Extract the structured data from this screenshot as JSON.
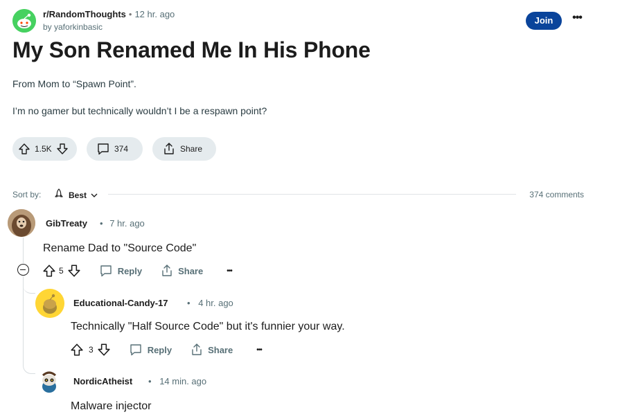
{
  "post": {
    "subreddit": "r/RandomThoughts",
    "time": "12 hr. ago",
    "author": "by yaforkinbasic",
    "join_label": "Join",
    "more_label": "•••",
    "title": "My Son Renamed Me In His Phone",
    "body_lines": [
      "From Mom to “Spawn Point”.",
      "I’m no gamer but technically wouldn’t I be a respawn point?"
    ],
    "votes": "1.5K",
    "comments": "374",
    "share_label": "Share"
  },
  "sort": {
    "label": "Sort by:",
    "value": "Best",
    "comment_count": "374 comments"
  },
  "comments": [
    {
      "author": "GibTreaty",
      "time": "7 hr. ago",
      "text": "Rename Dad to \"Source Code\"",
      "votes": "5",
      "reply_label": "Reply",
      "share_label": "Share",
      "more_label": "•••"
    },
    {
      "author": "Educational-Candy-17",
      "time": "4 hr. ago",
      "text": "Technically \"Half Source Code\" but it's funnier your way.",
      "votes": "3",
      "reply_label": "Reply",
      "share_label": "Share",
      "more_label": "•••"
    },
    {
      "author": "NordicAtheist",
      "time": "14 min. ago",
      "text": "Malware injector"
    }
  ],
  "colors": {
    "join": "#0a449b",
    "pill": "#e5ebee",
    "muted": "#576f76",
    "subreddit_avatar": "#46d160"
  }
}
